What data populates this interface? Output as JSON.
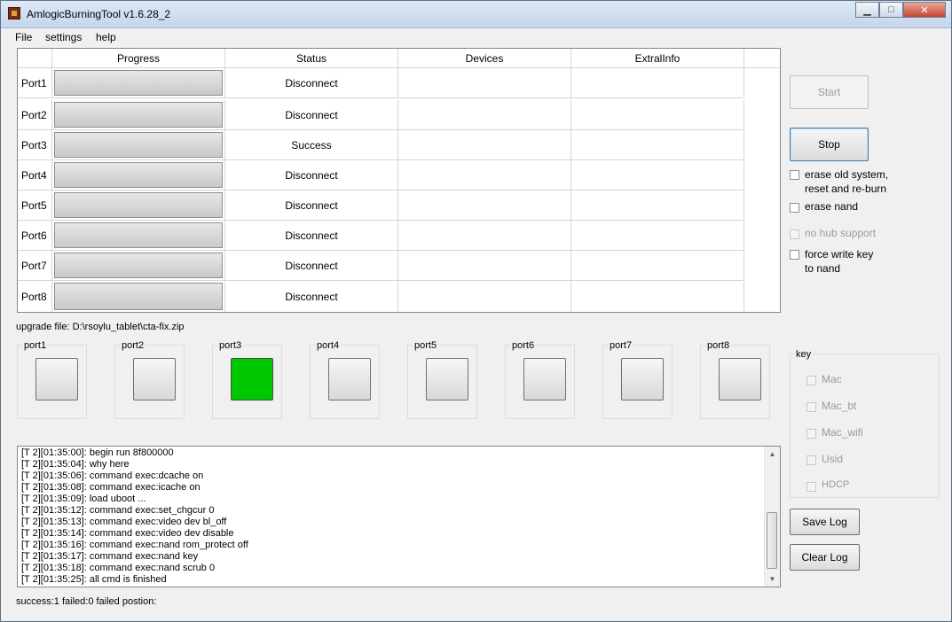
{
  "window": {
    "title": "AmlogicBurningTool  v1.6.28_2",
    "controls": {
      "minimize": "▁",
      "maximize": "□",
      "close": "✕"
    }
  },
  "menu": {
    "file": "File",
    "settings": "settings",
    "help": "help"
  },
  "grid": {
    "headers": {
      "progress": "Progress",
      "status": "Status",
      "devices": "Devices",
      "extra": "ExtralInfo"
    },
    "rows": [
      {
        "port": "Port1",
        "status": "Disconnect",
        "progress": 0
      },
      {
        "port": "Port2",
        "status": "Disconnect",
        "progress": 0
      },
      {
        "port": "Port3",
        "status": "Success",
        "progress": 0
      },
      {
        "port": "Port4",
        "status": "Disconnect",
        "progress": 0
      },
      {
        "port": "Port5",
        "status": "Disconnect",
        "progress": 0
      },
      {
        "port": "Port6",
        "status": "Disconnect",
        "progress": 0
      },
      {
        "port": "Port7",
        "status": "Disconnect",
        "progress": 0
      },
      {
        "port": "Port8",
        "status": "Disconnect",
        "progress": 0
      }
    ]
  },
  "controls": {
    "start": "Start",
    "stop": "Stop",
    "erase_old": "erase old system,\nreset and re-burn",
    "erase_nand": "erase nand",
    "no_hub": "no hub support",
    "force_write": "force write key\nto nand",
    "save_log": "Save Log",
    "clear_log": "Clear Log"
  },
  "upgrade_file": "upgrade file: D:\\rsoylu_tablet\\cta-fix.zip",
  "ports": [
    {
      "label": "port1",
      "state": "idle"
    },
    {
      "label": "port2",
      "state": "idle"
    },
    {
      "label": "port3",
      "state": "success"
    },
    {
      "label": "port4",
      "state": "idle"
    },
    {
      "label": "port5",
      "state": "idle"
    },
    {
      "label": "port6",
      "state": "idle"
    },
    {
      "label": "port7",
      "state": "idle"
    },
    {
      "label": "port8",
      "state": "idle"
    }
  ],
  "colors": {
    "success": "#00c800"
  },
  "key": {
    "title": "key",
    "items": [
      "Mac",
      "Mac_bt",
      "Mac_wifi",
      "Usid",
      "HDCP"
    ]
  },
  "log": {
    "lines": [
      "[T 2][01:35:00]: begin run 8f800000",
      "[T 2][01:35:04]: why here",
      "[T 2][01:35:06]: command exec:dcache on",
      "[T 2][01:35:08]: command exec:icache on",
      "[T 2][01:35:09]: load uboot ...",
      "[T 2][01:35:12]: command exec:set_chgcur 0",
      "[T 2][01:35:13]: command exec:video dev bl_off",
      "[T 2][01:35:14]: command exec:video dev disable",
      "[T 2][01:35:16]: command exec:nand rom_protect off",
      "[T 2][01:35:17]: command exec:nand key",
      "[T 2][01:35:18]: command exec:nand scrub 0",
      "[T 2][01:35:25]: all cmd is finished"
    ]
  },
  "status_line": "success:1 failed:0 failed postion:"
}
